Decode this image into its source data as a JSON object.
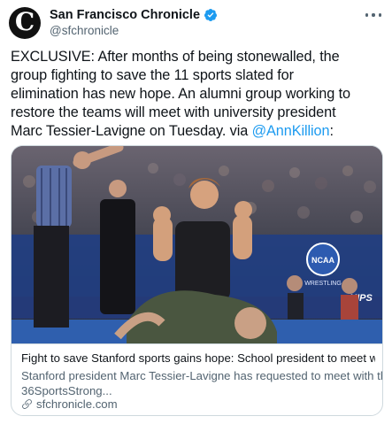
{
  "account": {
    "display_name": "San Francisco Chronicle",
    "handle": "@sfchronicle",
    "avatar_letter": "C",
    "verified": true
  },
  "tweet": {
    "lines": [
      "EXCLUSIVE: After months of being stonewalled, the",
      "group fighting to save the 11 sports slated for",
      "elimination has new hope. An alumni group working to",
      "restore the teams will meet with university president",
      "Marc Tessier-Lavigne on Tuesday. via "
    ],
    "mention": "@AnnKillion",
    "after_mention": ":"
  },
  "card": {
    "image_description_icon": "wrestling-photo",
    "banner_text": "NCAA",
    "banner_sub": "WRESTLING",
    "banner_right": "HIPS",
    "title": "Fight to save Stanford sports gains hope: School president to meet with a...",
    "description_lines": [
      "Stanford president Marc Tessier-Lavigne has requested to meet with the",
      "36SportsStrong..."
    ],
    "domain": "sfchronicle.com"
  },
  "colors": {
    "accent": "#1d9bf0",
    "text": "#0f1419",
    "muted": "#536471",
    "border": "#cfd9de"
  }
}
